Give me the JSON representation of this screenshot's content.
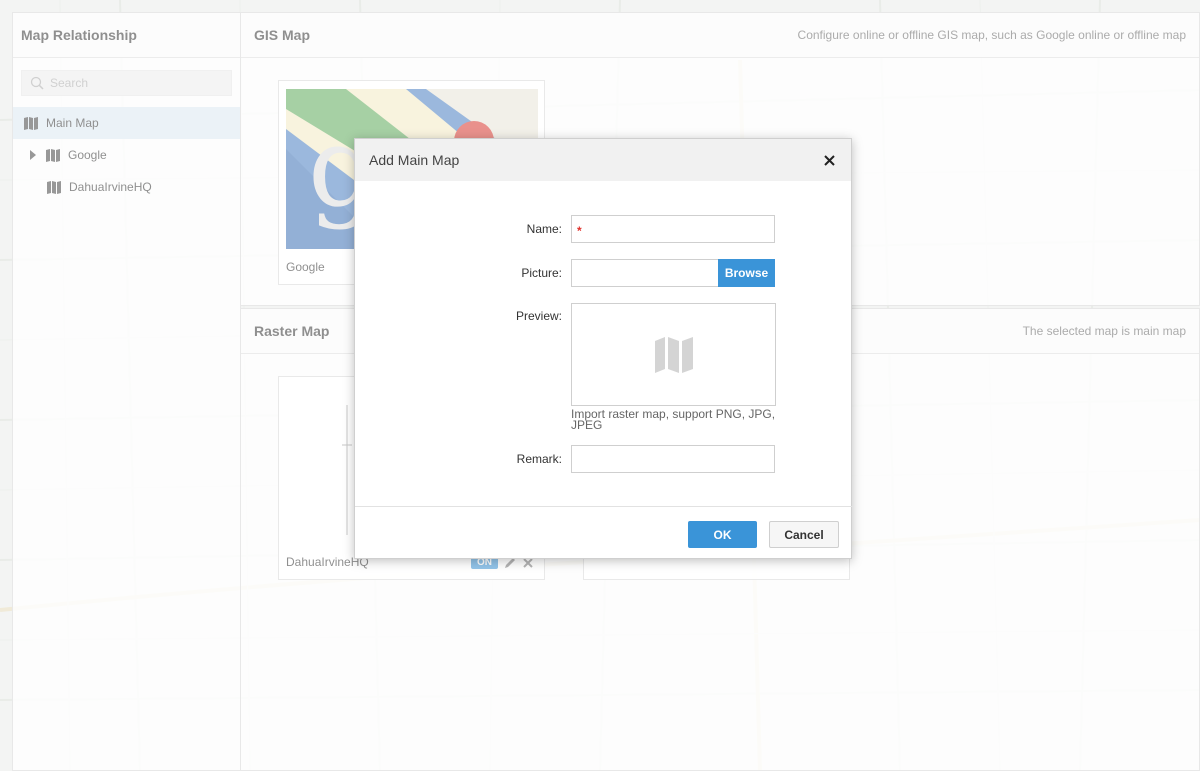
{
  "sidebar": {
    "title": "Map Relationship",
    "search_placeholder": "Search",
    "items": [
      {
        "label": "Main Map",
        "icon": "map-icon",
        "selected": true
      },
      {
        "label": "Google",
        "icon": "map-icon",
        "expandable": true
      },
      {
        "label": "DahuaIrvineHQ",
        "icon": "map-icon"
      }
    ]
  },
  "gis_section": {
    "title": "GIS Map",
    "hint": "Configure online or offline GIS map, such as Google online or offline map",
    "cards": [
      {
        "label": "Google"
      }
    ]
  },
  "raster_section": {
    "title": "Raster Map",
    "hint": "The selected map is main map",
    "cards": [
      {
        "label": "DahuaIrvineHQ",
        "badge": "ON"
      }
    ]
  },
  "dialog": {
    "title": "Add Main Map",
    "name_label": "Name:",
    "required_mark": "*",
    "picture_label": "Picture:",
    "browse_label": "Browse",
    "preview_label": "Preview:",
    "preview_hint": "Import raster map, support PNG, JPG, JPEG",
    "remark_label": "Remark:",
    "ok_label": "OK",
    "cancel_label": "Cancel"
  },
  "colors": {
    "accent": "#3a94d8",
    "required": "#e0302b",
    "selected_row": "#d7e4ee"
  }
}
